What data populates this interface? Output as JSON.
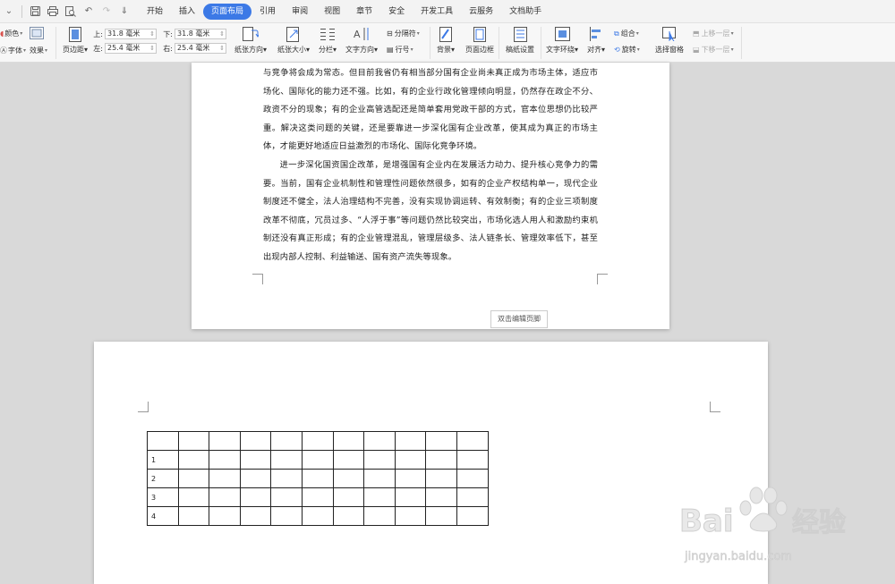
{
  "quick_access": {
    "icons": [
      "save-icon",
      "print-icon",
      "print-preview-icon",
      "undo-icon",
      "redo-icon",
      "customize-icon"
    ]
  },
  "tabs": [
    {
      "label": "开始",
      "active": false
    },
    {
      "label": "插入",
      "active": false
    },
    {
      "label": "页面布局",
      "active": true
    },
    {
      "label": "引用",
      "active": false
    },
    {
      "label": "审阅",
      "active": false
    },
    {
      "label": "视图",
      "active": false
    },
    {
      "label": "章节",
      "active": false
    },
    {
      "label": "安全",
      "active": false
    },
    {
      "label": "开发工具",
      "active": false
    },
    {
      "label": "云服务",
      "active": false
    },
    {
      "label": "文档助手",
      "active": false
    }
  ],
  "toolbar": {
    "color_label": "颜色",
    "font_label": "字体",
    "effect_label": "效果",
    "margins_label": "页边距",
    "margin_top_label": "上:",
    "margin_top_value": "31.8 毫米",
    "margin_left_label": "左:",
    "margin_left_value": "25.4 毫米",
    "margin_bottom_label": "下:",
    "margin_bottom_value": "31.8 毫米",
    "margin_right_label": "右:",
    "margin_right_value": "25.4 毫米",
    "orientation_label": "纸张方向",
    "size_label": "纸张大小",
    "columns_label": "分栏",
    "text_direction_label": "文字方向",
    "breaks_label": "分隔符",
    "line_numbers_label": "行号",
    "background_label": "背景",
    "page_border_label": "页面边框",
    "draft_settings_label": "稿纸设置",
    "wrap_text_label": "文字环绕",
    "align_label": "对齐",
    "group_label": "组合",
    "rotate_label": "旋转",
    "select_pane_label": "选择窗格",
    "bring_forward_label": "上移一层",
    "send_backward_label": "下移一层"
  },
  "document": {
    "paragraph1": "与竞争将会成为常态。但目前我省仍有相当部分国有企业尚未真正成为市场主体，适应市场化、国际化的能力还不强。比如，有的企业行政化管理倾向明显，仍然存在政企不分、政资不分的现象；有的企业高管选配还是简单套用党政干部的方式，官本位思想仍比较严重。解决这类问题的关键，还是要靠进一步深化国有企业改革，使其成为真正的市场主体，才能更好地适应日益激烈的市场化、国际化竞争环境。",
    "paragraph2": "进一步深化国资国企改革，是增强国有企业内在发展活力动力、提升核心竞争力的需要。当前，国有企业机制性和管理性问题依然很多，如有的企业产权结构单一，现代企业制度还不健全，法人治理结构不完善，没有实现协调运转、有效制衡；有的企业三项制度改革不彻底，冗员过多、“人浮于事”等问题仍然比较突出，市场化选人用人和激励约束机制还没有真正形成；有的企业管理混乱，管理层级多、法人链条长、管理效率低下，甚至出现内部人控制、利益输送、国有资产流失等现象。",
    "footer_hint": "双击编辑页脚",
    "table_row_labels": [
      "",
      "1",
      "2",
      "3",
      "4"
    ]
  },
  "watermark": {
    "brand": "Bai",
    "brand_cn": "经验",
    "url": "jingyan.baidu.com"
  },
  "colors": {
    "accent": "#3c79e6",
    "canvas": "#d9d9d9",
    "ribbon": "#f7f7f7"
  }
}
